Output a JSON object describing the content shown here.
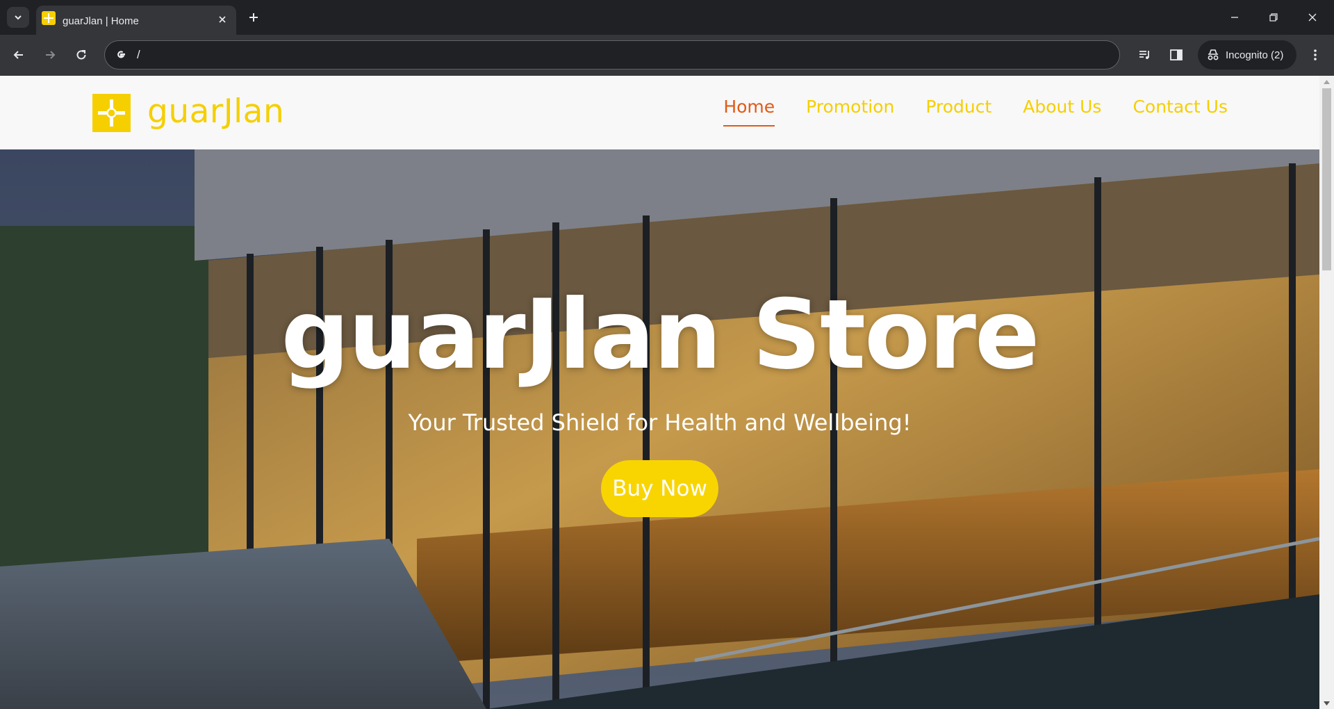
{
  "browser": {
    "tab_title": "guarJlan | Home",
    "url": "/",
    "incognito_label": "Incognito (2)"
  },
  "site": {
    "logo_text": "guarJlan",
    "nav": [
      {
        "label": "Home",
        "active": true
      },
      {
        "label": "Promotion",
        "active": false
      },
      {
        "label": "Product",
        "active": false
      },
      {
        "label": "About Us",
        "active": false
      },
      {
        "label": "Contact Us",
        "active": false
      }
    ],
    "hero": {
      "title": "guarJlan Store",
      "subtitle": "Your Trusted Shield for Health and Wellbeing!",
      "cta_label": "Buy Now"
    }
  },
  "colors": {
    "brand_yellow": "#f5cf00",
    "active_nav": "#e15a16",
    "chrome_dark": "#202124",
    "chrome_toolbar": "#35363a"
  }
}
